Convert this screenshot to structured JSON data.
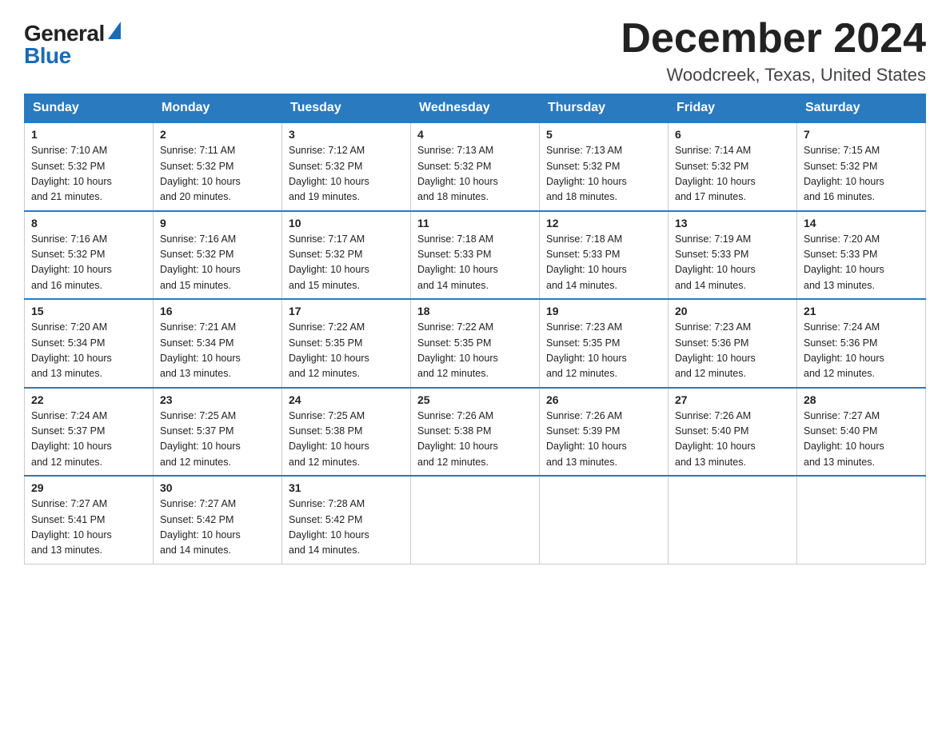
{
  "logo": {
    "general": "General",
    "blue": "Blue",
    "alt": "GeneralBlue logo"
  },
  "title": {
    "month_year": "December 2024",
    "location": "Woodcreek, Texas, United States"
  },
  "headers": [
    "Sunday",
    "Monday",
    "Tuesday",
    "Wednesday",
    "Thursday",
    "Friday",
    "Saturday"
  ],
  "weeks": [
    [
      {
        "day": "1",
        "sunrise": "7:10 AM",
        "sunset": "5:32 PM",
        "daylight": "10 hours and 21 minutes."
      },
      {
        "day": "2",
        "sunrise": "7:11 AM",
        "sunset": "5:32 PM",
        "daylight": "10 hours and 20 minutes."
      },
      {
        "day": "3",
        "sunrise": "7:12 AM",
        "sunset": "5:32 PM",
        "daylight": "10 hours and 19 minutes."
      },
      {
        "day": "4",
        "sunrise": "7:13 AM",
        "sunset": "5:32 PM",
        "daylight": "10 hours and 18 minutes."
      },
      {
        "day": "5",
        "sunrise": "7:13 AM",
        "sunset": "5:32 PM",
        "daylight": "10 hours and 18 minutes."
      },
      {
        "day": "6",
        "sunrise": "7:14 AM",
        "sunset": "5:32 PM",
        "daylight": "10 hours and 17 minutes."
      },
      {
        "day": "7",
        "sunrise": "7:15 AM",
        "sunset": "5:32 PM",
        "daylight": "10 hours and 16 minutes."
      }
    ],
    [
      {
        "day": "8",
        "sunrise": "7:16 AM",
        "sunset": "5:32 PM",
        "daylight": "10 hours and 16 minutes."
      },
      {
        "day": "9",
        "sunrise": "7:16 AM",
        "sunset": "5:32 PM",
        "daylight": "10 hours and 15 minutes."
      },
      {
        "day": "10",
        "sunrise": "7:17 AM",
        "sunset": "5:32 PM",
        "daylight": "10 hours and 15 minutes."
      },
      {
        "day": "11",
        "sunrise": "7:18 AM",
        "sunset": "5:33 PM",
        "daylight": "10 hours and 14 minutes."
      },
      {
        "day": "12",
        "sunrise": "7:18 AM",
        "sunset": "5:33 PM",
        "daylight": "10 hours and 14 minutes."
      },
      {
        "day": "13",
        "sunrise": "7:19 AM",
        "sunset": "5:33 PM",
        "daylight": "10 hours and 14 minutes."
      },
      {
        "day": "14",
        "sunrise": "7:20 AM",
        "sunset": "5:33 PM",
        "daylight": "10 hours and 13 minutes."
      }
    ],
    [
      {
        "day": "15",
        "sunrise": "7:20 AM",
        "sunset": "5:34 PM",
        "daylight": "10 hours and 13 minutes."
      },
      {
        "day": "16",
        "sunrise": "7:21 AM",
        "sunset": "5:34 PM",
        "daylight": "10 hours and 13 minutes."
      },
      {
        "day": "17",
        "sunrise": "7:22 AM",
        "sunset": "5:35 PM",
        "daylight": "10 hours and 12 minutes."
      },
      {
        "day": "18",
        "sunrise": "7:22 AM",
        "sunset": "5:35 PM",
        "daylight": "10 hours and 12 minutes."
      },
      {
        "day": "19",
        "sunrise": "7:23 AM",
        "sunset": "5:35 PM",
        "daylight": "10 hours and 12 minutes."
      },
      {
        "day": "20",
        "sunrise": "7:23 AM",
        "sunset": "5:36 PM",
        "daylight": "10 hours and 12 minutes."
      },
      {
        "day": "21",
        "sunrise": "7:24 AM",
        "sunset": "5:36 PM",
        "daylight": "10 hours and 12 minutes."
      }
    ],
    [
      {
        "day": "22",
        "sunrise": "7:24 AM",
        "sunset": "5:37 PM",
        "daylight": "10 hours and 12 minutes."
      },
      {
        "day": "23",
        "sunrise": "7:25 AM",
        "sunset": "5:37 PM",
        "daylight": "10 hours and 12 minutes."
      },
      {
        "day": "24",
        "sunrise": "7:25 AM",
        "sunset": "5:38 PM",
        "daylight": "10 hours and 12 minutes."
      },
      {
        "day": "25",
        "sunrise": "7:26 AM",
        "sunset": "5:38 PM",
        "daylight": "10 hours and 12 minutes."
      },
      {
        "day": "26",
        "sunrise": "7:26 AM",
        "sunset": "5:39 PM",
        "daylight": "10 hours and 13 minutes."
      },
      {
        "day": "27",
        "sunrise": "7:26 AM",
        "sunset": "5:40 PM",
        "daylight": "10 hours and 13 minutes."
      },
      {
        "day": "28",
        "sunrise": "7:27 AM",
        "sunset": "5:40 PM",
        "daylight": "10 hours and 13 minutes."
      }
    ],
    [
      {
        "day": "29",
        "sunrise": "7:27 AM",
        "sunset": "5:41 PM",
        "daylight": "10 hours and 13 minutes."
      },
      {
        "day": "30",
        "sunrise": "7:27 AM",
        "sunset": "5:42 PM",
        "daylight": "10 hours and 14 minutes."
      },
      {
        "day": "31",
        "sunrise": "7:28 AM",
        "sunset": "5:42 PM",
        "daylight": "10 hours and 14 minutes."
      },
      null,
      null,
      null,
      null
    ]
  ],
  "labels": {
    "sunrise": "Sunrise:",
    "sunset": "Sunset:",
    "daylight": "Daylight:"
  }
}
